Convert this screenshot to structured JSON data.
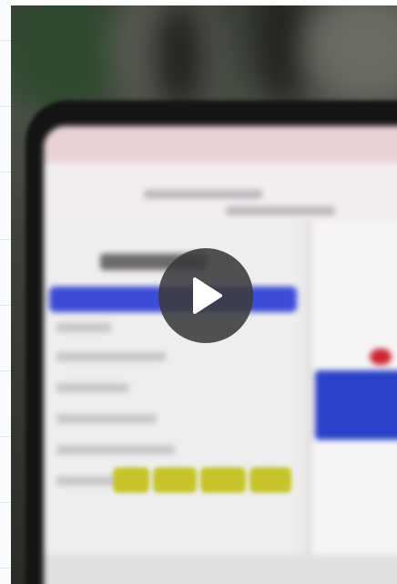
{
  "player": {
    "play_button_icon": "play-icon",
    "play_button_label": "",
    "play_icon_color": "#ffffff",
    "play_button_color": "#3a3a3e"
  },
  "scene": {
    "description_visible_text": ""
  }
}
